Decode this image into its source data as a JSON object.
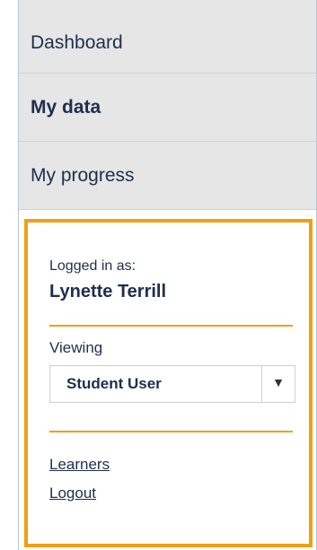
{
  "nav": {
    "items": [
      {
        "label": "Dashboard",
        "active": false
      },
      {
        "label": "My data",
        "active": true
      },
      {
        "label": "My progress",
        "active": false
      }
    ]
  },
  "user_box": {
    "logged_in_label": "Logged in as:",
    "user_name": "Lynette Terrill",
    "viewing_label": "Viewing",
    "viewing_selected": "Student User",
    "dropdown_icon": "caret-down-icon",
    "links": {
      "learners": "Learners",
      "logout": "Logout"
    }
  },
  "colors": {
    "accent_border": "#eea013",
    "text": "#1e2f4d",
    "nav_background": "#e6e6e6"
  }
}
